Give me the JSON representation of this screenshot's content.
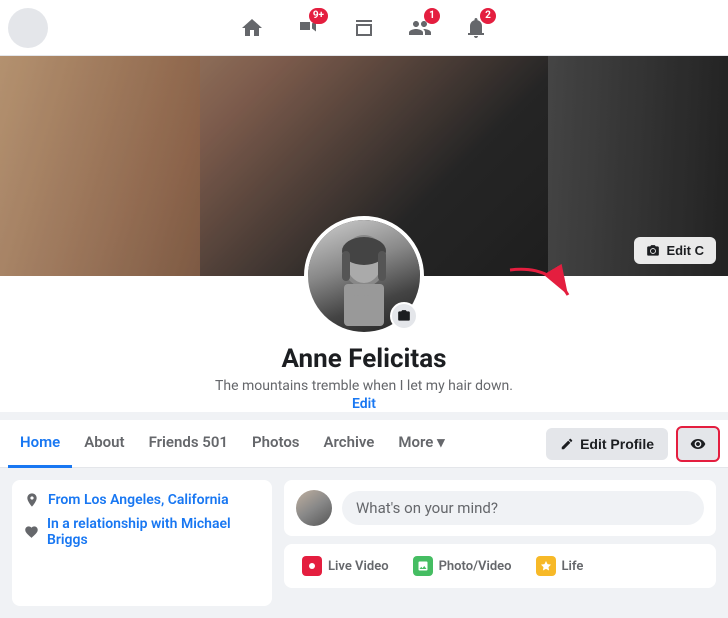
{
  "nav": {
    "badges": {
      "video": "9+",
      "friends": "1",
      "notifications": "2"
    }
  },
  "cover": {
    "edit_label": "Edit C"
  },
  "profile": {
    "name": "Anne Felicitas",
    "bio": "The mountains tremble when I let my hair down.",
    "edit_bio_label": "Edit"
  },
  "tabs": {
    "items": [
      {
        "label": "Home",
        "active": true
      },
      {
        "label": "About"
      },
      {
        "label": "Friends 501"
      },
      {
        "label": "Photos"
      },
      {
        "label": "Archive"
      },
      {
        "label": "More ▾"
      }
    ],
    "edit_profile_label": "Edit Profile",
    "eye_label": "👁"
  },
  "left_panel": {
    "location": "Los Angeles, California",
    "relationship": "Michael Briggs"
  },
  "post_box": {
    "placeholder": "What's on your mind?",
    "actions": [
      {
        "label": "Live Video",
        "type": "live"
      },
      {
        "label": "Photo/Video",
        "type": "photo"
      },
      {
        "label": "Life",
        "type": "life"
      }
    ]
  }
}
